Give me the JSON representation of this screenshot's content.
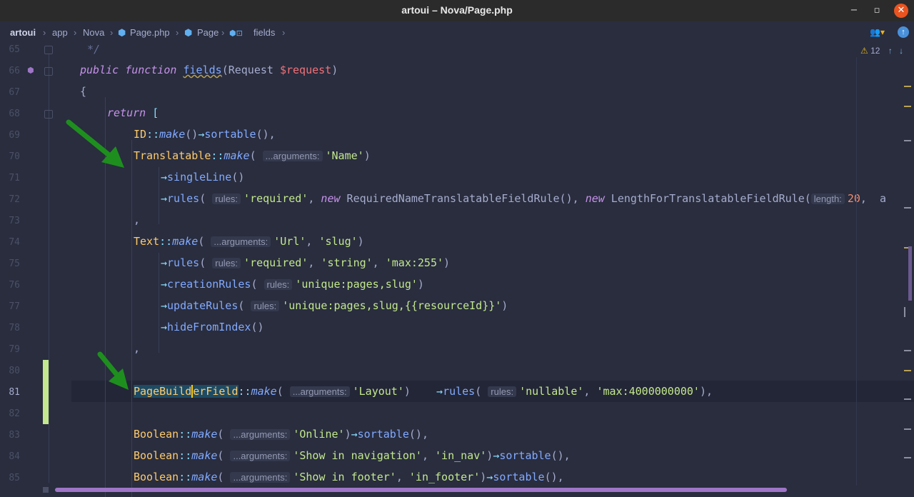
{
  "window": {
    "title": "artoui – Nova/Page.php",
    "minimize": "−",
    "maximize": "▫",
    "close": "✕"
  },
  "breadcrumb": {
    "project": "artoui",
    "sep": "›",
    "dir1": "app",
    "dir2": "Nova",
    "file": "Page.php",
    "class": "Page",
    "method": "fields"
  },
  "inspections": {
    "warnings": "12",
    "warning_icon": "warning-triangle-icon"
  },
  "line_numbers": [
    "65",
    "66",
    "67",
    "68",
    "69",
    "70",
    "71",
    "72",
    "73",
    "74",
    "75",
    "76",
    "77",
    "78",
    "79",
    "80",
    "81",
    "82",
    "83",
    "84",
    "85"
  ],
  "code": {
    "l65": "*/",
    "l66": {
      "kw1": "public",
      "kw2": "function",
      "fn": "fields",
      "p1": "(Request ",
      "var": "$request",
      "p2": ")"
    },
    "l67": "{",
    "l68": {
      "kw": "return",
      "p": " ["
    },
    "l69": {
      "cls": "ID",
      "op": "::",
      "m": "make",
      "p1": "()",
      "arrow": "→",
      "fn": "sortable",
      "p2": "(),"
    },
    "l70": {
      "cls": "Translatable",
      "op": "::",
      "m": "make",
      "p1": "( ",
      "hint": "...arguments:",
      "str": "'Name'",
      "p2": ")"
    },
    "l71": {
      "arrow": "→",
      "fn": "singleLine",
      "p": "()"
    },
    "l72": {
      "arrow": "→",
      "fn": "rules",
      "p1": "( ",
      "hint1": "rules:",
      "str": "'required'",
      "p2": ", ",
      "kw": "new",
      "c1": " RequiredNameTranslatableFieldRule(), ",
      "kw2": "new",
      "c2": " LengthForTranslatableFieldRule(",
      "hint2": "length:",
      "num": "20",
      "p3": ",  a"
    },
    "l73": ",",
    "l74": {
      "cls": "Text",
      "op": "::",
      "m": "make",
      "p1": "( ",
      "hint": "...arguments:",
      "s1": "'Url'",
      "p2": ", ",
      "s2": "'slug'",
      "p3": ")"
    },
    "l75": {
      "arrow": "→",
      "fn": "rules",
      "p1": "( ",
      "hint": "rules:",
      "s1": "'required'",
      "p2": ", ",
      "s2": "'string'",
      "p3": ", ",
      "s3": "'max:255'",
      "p4": ")"
    },
    "l76": {
      "arrow": "→",
      "fn": "creationRules",
      "p1": "( ",
      "hint": "rules:",
      "s1": "'unique:pages,slug'",
      "p2": ")"
    },
    "l77": {
      "arrow": "→",
      "fn": "updateRules",
      "p1": "( ",
      "hint": "rules:",
      "s1": "'unique:pages,slug,{{resourceId}}'",
      "p2": ")"
    },
    "l78": {
      "arrow": "→",
      "fn": "hideFromIndex",
      "p": "()"
    },
    "l79": ",",
    "l81": {
      "cls_a": "PageBuild",
      "cls_b": "erField",
      "op": "::",
      "m": "make",
      "p1": "( ",
      "hint": "...arguments:",
      "s1": "'Layout'",
      "p2": ")    ",
      "arrow": "→",
      "fn": "rules",
      "p3": "( ",
      "hint2": "rules:",
      "s2": "'nullable'",
      "p4": ", ",
      "s3": "'max:4000000000'",
      "p5": "),"
    },
    "l83": {
      "cls": "Boolean",
      "op": "::",
      "m": "make",
      "p1": "( ",
      "hint": "...arguments:",
      "s1": "'Online'",
      "p2": ")",
      "arrow": "→",
      "fn": "sortable",
      "p3": "(),"
    },
    "l84": {
      "cls": "Boolean",
      "op": "::",
      "m": "make",
      "p1": "( ",
      "hint": "...arguments:",
      "s1": "'Show in navigation'",
      "p2": ", ",
      "s2": "'in_nav'",
      "p3": ")",
      "arrow": "→",
      "fn": "sortable",
      "p4": "(),"
    },
    "l85": {
      "cls": "Boolean",
      "op": "::",
      "m": "make",
      "p1": "( ",
      "hint": "...arguments:",
      "s1": "'Show in footer'",
      "p2": ", ",
      "s2": "'in_footer'",
      "p3": ")",
      "arrow": "→",
      "fn": "sortable",
      "p4": "(),"
    }
  },
  "colors": {
    "accent_green": "#c3e88d",
    "arrow_green": "#1e8f1e",
    "scrollbar": "#9e75c7",
    "close": "#e95420"
  }
}
